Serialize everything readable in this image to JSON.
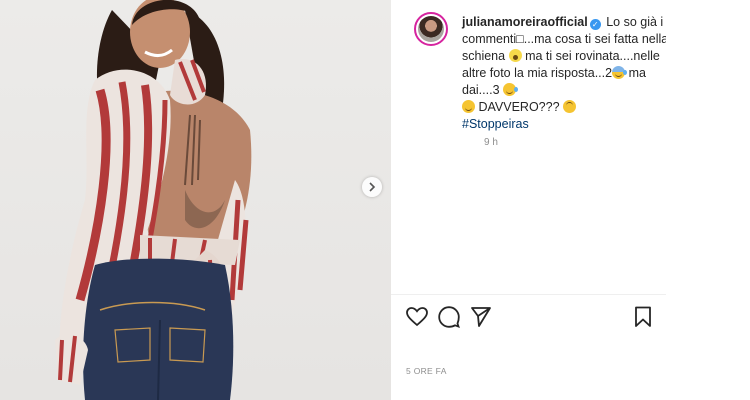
{
  "post": {
    "username": "julianamoreiraofficial",
    "caption_part1": "Lo so già i commenti□...ma cosa ti sei fatta nella schiena",
    "caption_part2": "ma ti sei rovinata....nelle altre foto la mia risposta...2",
    "caption_part3": "ma dai....3",
    "caption_part4": "DAVVERO???",
    "hashtag": "#Stoppeiras",
    "time_ago": "9 h",
    "date_label": "5 ORE FA"
  },
  "icons": {
    "verified": "verified-badge-icon",
    "like": "heart-icon",
    "comment": "comment-icon",
    "share": "paper-plane-icon",
    "save": "bookmark-icon",
    "next": "chevron-right-icon"
  },
  "colors": {
    "verified": "#3897f0",
    "hashtag": "#00376b",
    "muted": "#8e8e8e",
    "story_ring": "#d6249f"
  }
}
